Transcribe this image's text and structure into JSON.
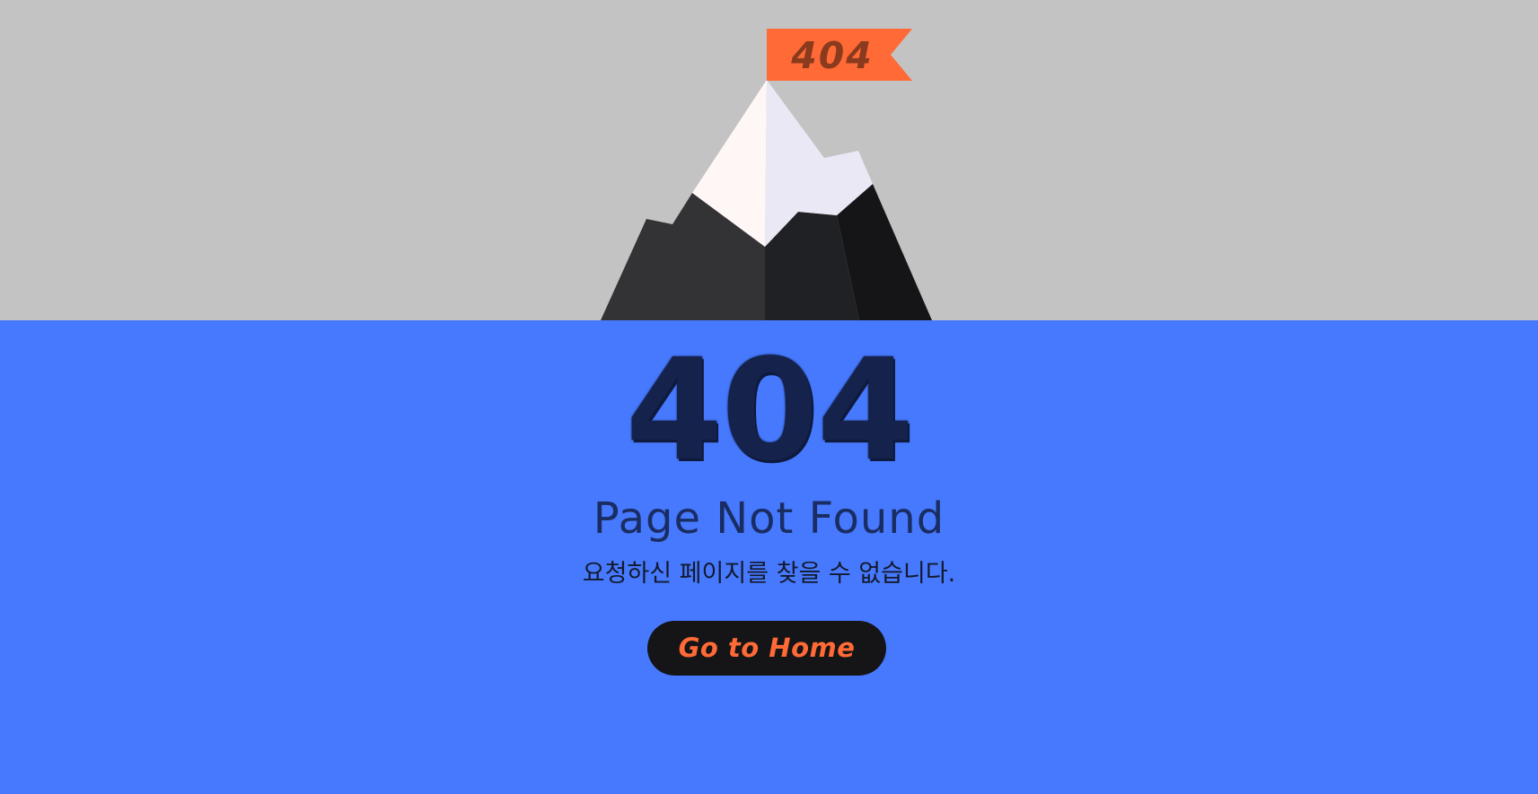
{
  "flag": {
    "code": "404"
  },
  "main": {
    "code": "404",
    "title": "Page Not Found",
    "subtitle": "요청하신 페이지를 찾을 수 없습니다.",
    "home_button_label": "Go to Home"
  },
  "colors": {
    "sky": "#c3c3c3",
    "sea": "#4679fe",
    "flag": "#ff6a36",
    "flag_text": "#8a3a1d",
    "code_text": "#15224c",
    "title_text": "#1a2d63",
    "button_bg": "#151517",
    "button_text": "#ff6a36"
  }
}
